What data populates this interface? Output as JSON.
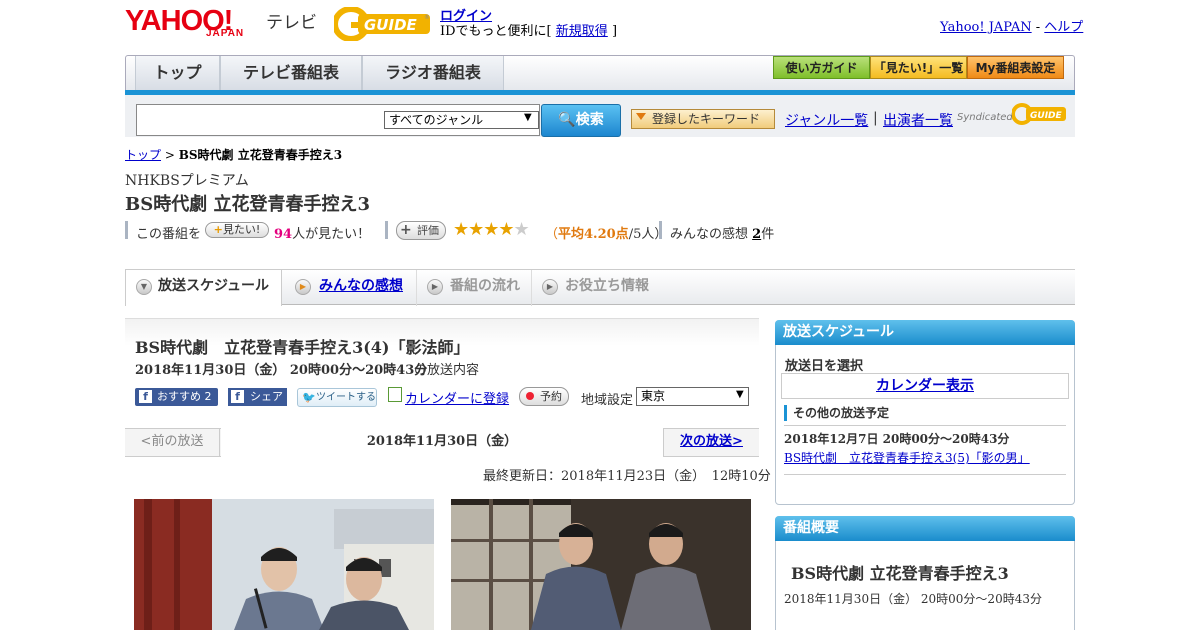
{
  "header": {
    "logo_yahoo": "YAHOO!",
    "logo_japan": "JAPAN",
    "logo_tv": "テレビ",
    "logo_gguide": "G GUIDE",
    "login_label": "ログイン",
    "id_text_prefix": "IDでもっと便利に[",
    "signup_label": "新規取得",
    "id_text_suffix": "]",
    "yahoo_japan_link": "Yahoo! JAPAN",
    "link_sep": " - ",
    "help_link": "ヘルプ"
  },
  "nav": {
    "tabs": [
      "トップ",
      "テレビ番組表",
      "ラジオ番組表"
    ],
    "guide_buttons": [
      "使い方ガイド",
      "「見たい!」一覧",
      "My番組表設定"
    ]
  },
  "search": {
    "placeholder": "",
    "genre_selected": "すべてのジャンル",
    "button_label": "検索",
    "keyword_button": "登録したキーワード",
    "genre_list_link": "ジャンル一覧",
    "separator": "|",
    "performer_link": "出演者一覧",
    "syndicated": "Syndicated"
  },
  "breadcrumb": {
    "top": "トップ",
    "sep": " > ",
    "current": "BS時代劇 立花登青春手控え3"
  },
  "program": {
    "channel": "NHKBSプレミアム",
    "title": "BS時代劇 立花登青春手控え3",
    "want_prefix": "この番組を",
    "want_button": "見たい!",
    "want_count": "94",
    "want_suffix": "人が見たい！",
    "rate_button": "評価",
    "stars_filled": "★★★★",
    "stars_empty": "★",
    "rating_open": "（",
    "rating_avg": "平均4.20点",
    "rating_count": "/5人）",
    "review_prefix": "みんなの感想 ",
    "review_count": "2",
    "review_suffix": "件"
  },
  "tabs": [
    {
      "label": "放送スケジュール"
    },
    {
      "label": "みんなの感想"
    },
    {
      "label": "番組の流れ"
    },
    {
      "label": "お役立ち情報"
    }
  ],
  "episode": {
    "title": "BS時代劇　立花登青春手控え3(4)「影法師」",
    "date": "2018年11月30日（金） 20時00分～20時43分",
    "date_suffix": "の放送内容",
    "fb_recommend": "おすすめ 2",
    "fb_share": "シェア",
    "tweet": "ツイートする",
    "calendar_link": "カレンダーに登録",
    "reserve": "予約",
    "region_label": "地域設定",
    "region_selected": "東京"
  },
  "date_nav": {
    "prev": "<前の放送",
    "current": "2018年11月30日（金）",
    "next": "次の放送>"
  },
  "last_updated": "最終更新日：2018年11月23日（金）　12時10分",
  "sidebar": {
    "schedule_header": "放送スケジュール",
    "select_date_label": "放送日を選択",
    "calendar_display": "カレンダー表示",
    "other_label": "その他の放送予定",
    "other_date": "2018年12月7日  20時00分～20時43分",
    "other_link": "BS時代劇　立花登青春手控え3(5)「影の男」",
    "summary_header": "番組概要",
    "summary_title": "BS時代劇 立花登青春手控え3",
    "summary_date": "2018年11月30日（金）  20時00分～20時43分"
  },
  "colors": {
    "accent_blue": "#1b93d5",
    "yahoo_red": "#e60012",
    "star_gold": "#e8a200",
    "rating_orange": "#e07a10",
    "want_pink": "#e4007f"
  }
}
